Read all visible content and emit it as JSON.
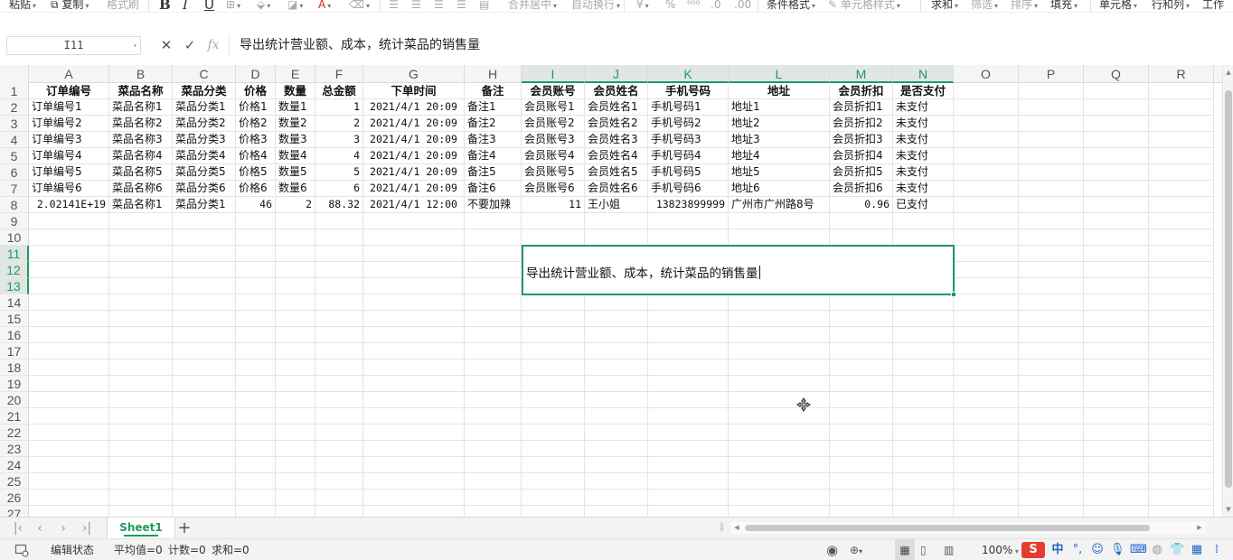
{
  "ribbon": {
    "paste": "粘贴",
    "copy": "复制",
    "format_painter": "格式刷",
    "bold": "B",
    "italic": "I",
    "underline": "U",
    "font_color": "A",
    "merge_center": "合并居中",
    "wrap_text": "自动换行",
    "currency": "¥",
    "percent": "%",
    "conditional_format": "条件格式",
    "cell_style": "单元格样式",
    "sum": "求和",
    "filter": "筛选",
    "sort": "排序",
    "fill": "填充",
    "cell": "单元格",
    "row_col": "行和列",
    "worksheet": "工作"
  },
  "formula_bar": {
    "name_box": "I11",
    "fx": "fx",
    "content": "导出统计营业额、成本，统计菜品的销售量"
  },
  "columns": [
    "A",
    "B",
    "C",
    "D",
    "E",
    "F",
    "G",
    "H",
    "I",
    "J",
    "K",
    "L",
    "M",
    "N",
    "O",
    "P",
    "Q",
    "R"
  ],
  "selected_columns": [
    "I",
    "J",
    "K",
    "L",
    "M",
    "N"
  ],
  "rows": [
    "1",
    "2",
    "3",
    "4",
    "5",
    "6",
    "7",
    "8",
    "9",
    "10",
    "11",
    "12",
    "13",
    "14",
    "15",
    "16",
    "17",
    "18",
    "19",
    "20",
    "21",
    "22",
    "23",
    "24",
    "25",
    "26",
    "27"
  ],
  "selected_rows": [
    "11",
    "12",
    "13"
  ],
  "table": {
    "headers": [
      "订单编号",
      "菜品名称",
      "菜品分类",
      "价格",
      "数量",
      "总金额",
      "下单时间",
      "备注",
      "会员账号",
      "会员姓名",
      "手机号码",
      "地址",
      "会员折扣",
      "是否支付"
    ],
    "rows": [
      [
        "订单编号1",
        "菜品名称1",
        "菜品分类1",
        "价格1",
        "数量1",
        "1",
        "2021/4/1 20:09",
        "备注1",
        "会员账号1",
        "会员姓名1",
        "手机号码1",
        "地址1",
        "会员折扣1",
        "未支付"
      ],
      [
        "订单编号2",
        "菜品名称2",
        "菜品分类2",
        "价格2",
        "数量2",
        "2",
        "2021/4/1 20:09",
        "备注2",
        "会员账号2",
        "会员姓名2",
        "手机号码2",
        "地址2",
        "会员折扣2",
        "未支付"
      ],
      [
        "订单编号3",
        "菜品名称3",
        "菜品分类3",
        "价格3",
        "数量3",
        "3",
        "2021/4/1 20:09",
        "备注3",
        "会员账号3",
        "会员姓名3",
        "手机号码3",
        "地址3",
        "会员折扣3",
        "未支付"
      ],
      [
        "订单编号4",
        "菜品名称4",
        "菜品分类4",
        "价格4",
        "数量4",
        "4",
        "2021/4/1 20:09",
        "备注4",
        "会员账号4",
        "会员姓名4",
        "手机号码4",
        "地址4",
        "会员折扣4",
        "未支付"
      ],
      [
        "订单编号5",
        "菜品名称5",
        "菜品分类5",
        "价格5",
        "数量5",
        "5",
        "2021/4/1 20:09",
        "备注5",
        "会员账号5",
        "会员姓名5",
        "手机号码5",
        "地址5",
        "会员折扣5",
        "未支付"
      ],
      [
        "订单编号6",
        "菜品名称6",
        "菜品分类6",
        "价格6",
        "数量6",
        "6",
        "2021/4/1 20:09",
        "备注6",
        "会员账号6",
        "会员姓名6",
        "手机号码6",
        "地址6",
        "会员折扣6",
        "未支付"
      ],
      [
        "2.02141E+19",
        "菜品名称1",
        "菜品分类1",
        "46",
        "2",
        "88.32",
        "2021/4/1 12:00",
        "不要加辣",
        "11",
        "王小姐",
        "13823899999",
        "广州市广州路8号",
        "0.96",
        "已支付"
      ]
    ]
  },
  "merged_cell": {
    "ref": "I11:N13",
    "text": "导出统计营业额、成本，统计菜品的销售量"
  },
  "sheet_tabs": {
    "active": "Sheet1",
    "add": "+"
  },
  "status_bar": {
    "mode": "编辑状态",
    "average": "平均值=0",
    "count": "计数=0",
    "sum": "求和=0",
    "zoom": "100%",
    "ime_lang": "中"
  },
  "colors": {
    "accent": "#1f9a5e",
    "header_bg": "#f5f5f5",
    "grid_line": "#e4e4e4"
  }
}
